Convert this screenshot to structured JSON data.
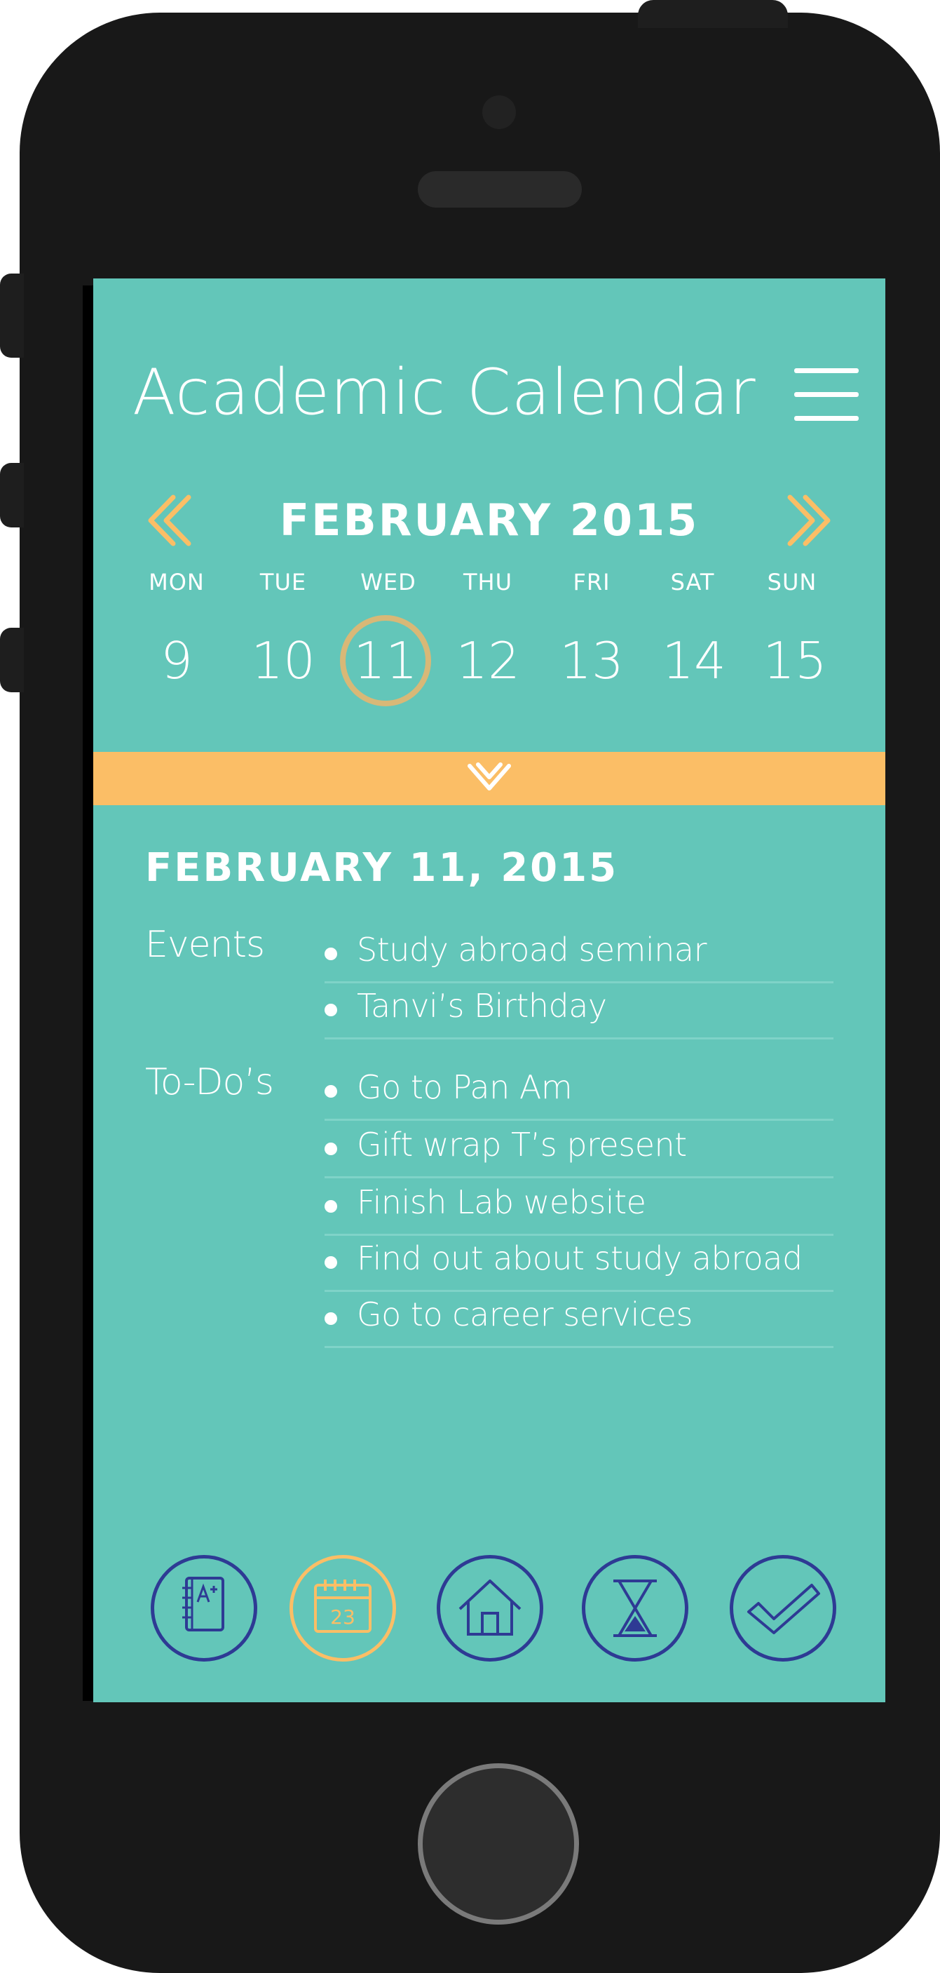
{
  "app": {
    "title": "Academic Calendar"
  },
  "calendar": {
    "month_label": "FEBRUARY 2015",
    "weekdays": [
      "MON",
      "TUE",
      "WED",
      "THU",
      "FRI",
      "SAT",
      "SUN"
    ],
    "days": [
      "9",
      "10",
      "11",
      "12",
      "13",
      "14",
      "15"
    ],
    "selected_day": "11"
  },
  "detail": {
    "date_title": "FEBRUARY 11, 2015",
    "events_label": "Events",
    "events": [
      "Study abroad seminar",
      "Tanvi’s Birthday"
    ],
    "todos_label": "To-Do’s",
    "todos": [
      "Go to Pan Am",
      "Gift wrap T’s present",
      "Finish Lab website",
      "Find out about study abroad",
      "Go to career services"
    ]
  },
  "nav": {
    "items": [
      {
        "icon": "notebook-grade-icon"
      },
      {
        "icon": "calendar-icon",
        "date_text": "23",
        "active": true
      },
      {
        "icon": "home-icon"
      },
      {
        "icon": "hourglass-icon"
      },
      {
        "icon": "checkmark-icon"
      }
    ]
  },
  "colors": {
    "screen_bg": "#63c6b9",
    "accent_orange": "#fbbe66",
    "selected_ring": "#d8b877",
    "nav_icon": "#2e3a94",
    "phone_body": "#181818"
  }
}
